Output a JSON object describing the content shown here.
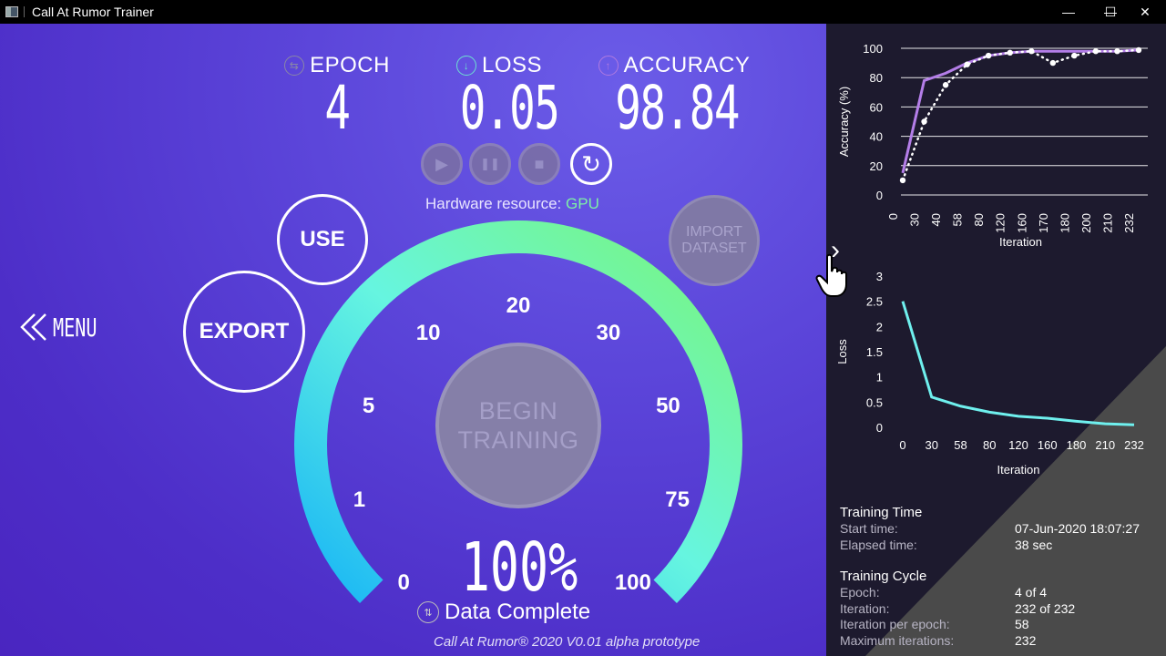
{
  "window": {
    "title": "Call At Rumor Trainer",
    "minimize": "—",
    "maximize": "☐",
    "close": "✕"
  },
  "stats": {
    "epoch": {
      "label": "EPOCH",
      "value": "4",
      "color": "#8a87a6"
    },
    "loss": {
      "label": "LOSS",
      "value": "0.05",
      "color": "#6de0d0"
    },
    "accuracy": {
      "label": "ACCURACY",
      "value": "98.84",
      "color": "#b07ae0"
    }
  },
  "controls": {
    "play": "▶",
    "pause": "❚❚",
    "stop": "■",
    "reset": "↻"
  },
  "hardware": {
    "label": "Hardware resource: ",
    "value": "GPU"
  },
  "buttons": {
    "use": "USE",
    "export": "EXPORT",
    "menu": "MENU",
    "import_line1": "IMPORT",
    "import_line2": "DATASET",
    "begin_line1": "BEGIN",
    "begin_line2": "TRAINING"
  },
  "gauge": {
    "ticks": [
      "0",
      "1",
      "5",
      "10",
      "20",
      "30",
      "50",
      "75",
      "100"
    ],
    "progress_percent": 100,
    "gradient": [
      "#19b6f5",
      "#66f5e0",
      "#79f57a"
    ]
  },
  "progress": {
    "percent_text": "100%",
    "status": "Data Complete"
  },
  "footer": "Call At Rumor® 2020 V0.01 alpha prototype",
  "chart_data": [
    {
      "type": "line",
      "ylabel": "Accuracy (%)",
      "xlabel": "Iteration",
      "categories": [
        "0",
        "30",
        "40",
        "58",
        "80",
        "120",
        "160",
        "170",
        "180",
        "200",
        "210",
        "232"
      ],
      "ylim": [
        0,
        100
      ],
      "yticks": [
        0,
        20,
        40,
        60,
        80,
        100
      ],
      "series": [
        {
          "name": "",
          "style": "solid",
          "color": "#b47ee8",
          "values": [
            15,
            78,
            83,
            90,
            95,
            97,
            98,
            98,
            98,
            98,
            98,
            98.8
          ]
        },
        {
          "name": "",
          "style": "dotted",
          "color": "#ffffff",
          "values": [
            10,
            50,
            75,
            89,
            95,
            97,
            98,
            90,
            95,
            98,
            98,
            98.8
          ]
        }
      ],
      "grid": true
    },
    {
      "type": "line",
      "ylabel": "Loss",
      "xlabel": "Iteration",
      "categories": [
        "0",
        "30",
        "58",
        "80",
        "120",
        "160",
        "180",
        "210",
        "232"
      ],
      "ylim": [
        0,
        3
      ],
      "yticks": [
        "0",
        "0.5",
        "1",
        "1.5",
        "2",
        "2.5",
        "3"
      ],
      "series": [
        {
          "name": "",
          "color": "#6ff0ee",
          "values": [
            2.5,
            0.6,
            0.42,
            0.3,
            0.22,
            0.18,
            0.12,
            0.07,
            0.05
          ]
        }
      ],
      "grid": false
    }
  ],
  "training_time": {
    "heading": "Training Time",
    "rows": [
      {
        "k": "Start time:",
        "v": "07-Jun-2020 18:07:27"
      },
      {
        "k": "Elapsed time:",
        "v": "38 sec"
      }
    ]
  },
  "training_cycle": {
    "heading": "Training Cycle",
    "rows": [
      {
        "k": "Epoch:",
        "v": "4 of 4"
      },
      {
        "k": "Iteration:",
        "v": "232 of 232"
      },
      {
        "k": "Iteration per epoch:",
        "v": "58"
      },
      {
        "k": "Maximum iterations:",
        "v": "232"
      }
    ]
  },
  "side_toggle": "›"
}
